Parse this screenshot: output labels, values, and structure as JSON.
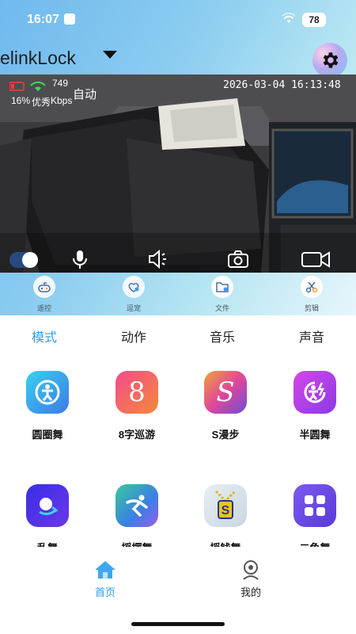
{
  "status_bar": {
    "time": "16:07",
    "battery": "78"
  },
  "header": {
    "device_name": "elinkLock",
    "settings_icon": "gear-icon"
  },
  "video": {
    "signal_rate": "749",
    "battery": "16%",
    "quality": "优秀",
    "rate_unit": "Kbps",
    "mode": "自动",
    "timestamp": "2026-03-04  16:13:48",
    "controls": [
      "toggle",
      "microphone-icon",
      "speaker-icon",
      "camera-icon",
      "video-camera-icon"
    ]
  },
  "function_bar": {
    "items": [
      {
        "label": "遥控",
        "icon": "gamepad-icon",
        "active": false
      },
      {
        "label": "逗宠",
        "icon": "pet-icon",
        "active": false
      },
      {
        "label": "文件",
        "icon": "folder-icon",
        "active": true
      },
      {
        "label": "剪辑",
        "icon": "scissors-icon",
        "active": true
      }
    ]
  },
  "tabs": [
    {
      "label": "模式",
      "active": true
    },
    {
      "label": "动作",
      "active": false
    },
    {
      "label": "音乐",
      "active": false
    },
    {
      "label": "声音",
      "active": false
    }
  ],
  "modes": [
    {
      "label": "圆圈舞",
      "icon": "circle-dance-icon",
      "colors": [
        "#38d0ef",
        "#3f79e6"
      ]
    },
    {
      "label": "8字巡游",
      "icon": "figure-eight-icon",
      "glyph": "8",
      "colors": [
        "#f54a8a",
        "#f28a3a"
      ]
    },
    {
      "label": "S漫步",
      "icon": "s-walk-icon",
      "glyph": "S",
      "colors": [
        "#f0a23a",
        "#e0479a",
        "#6b4ed8"
      ]
    },
    {
      "label": "半圆舞",
      "icon": "half-circle-dance-icon",
      "colors": [
        "#d646e8",
        "#8a3ae6"
      ]
    },
    {
      "label": "乱舞",
      "icon": "rotate-icon",
      "colors": [
        "#3b2ee6",
        "#6a38e8"
      ]
    },
    {
      "label": "摇摆舞",
      "icon": "dancer-icon",
      "colors": [
        "#39c99a",
        "#3b7ee6",
        "#9b5ee8"
      ]
    },
    {
      "label": "摇钱舞",
      "icon": "chain-s-icon",
      "glyph": "S",
      "colors": [
        "#e8eef4",
        "#c9d6e2"
      ]
    },
    {
      "label": "二龟舞",
      "icon": "grid-icon",
      "colors": [
        "#7a5af0",
        "#5a3ad8"
      ]
    }
  ],
  "tabbar": {
    "items": [
      {
        "label": "首页",
        "icon": "home-icon",
        "active": true
      },
      {
        "label": "我的",
        "icon": "profile-icon",
        "active": false
      }
    ]
  }
}
